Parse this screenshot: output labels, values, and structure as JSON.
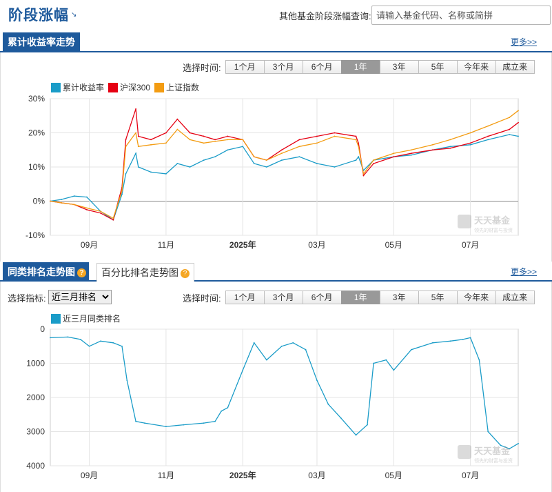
{
  "header": {
    "title": "阶段涨幅",
    "arrow": "↘",
    "query_label": "其他基金阶段涨幅查询:",
    "query_placeholder": "请输入基金代码、名称或简拼"
  },
  "section1": {
    "tab": "累计收益率走势",
    "more": "更多>>",
    "time_label": "选择时间:",
    "time_buttons": [
      "1个月",
      "3个月",
      "6个月",
      "1年",
      "3年",
      "5年",
      "今年来",
      "成立来"
    ],
    "active_time": "1年"
  },
  "section2": {
    "tab": "同类排名走势图",
    "tab2": "百分比排名走势图",
    "more": "更多>>",
    "indicator_label": "选择指标:",
    "indicator_value": "近三月排名",
    "time_label": "选择时间:",
    "time_buttons": [
      "1个月",
      "3个月",
      "6个月",
      "1年",
      "3年",
      "5年",
      "今年来",
      "成立来"
    ],
    "active_time": "1年"
  },
  "watermark": {
    "brand": "天天基金",
    "slogan": "领先的财富与投资"
  },
  "chart_data": [
    {
      "type": "line",
      "title": "",
      "xlabel": "",
      "ylabel": "",
      "y_unit": "%",
      "ylim": [
        -10,
        30
      ],
      "y_ticks": [
        "30%",
        "20%",
        "10%",
        "0%",
        "-10%"
      ],
      "y_tick_values": [
        30,
        20,
        10,
        0,
        -10
      ],
      "x_range": [
        "2024-08-01",
        "2025-08-08"
      ],
      "x_ticks": [
        "09月",
        "11月",
        "2025年",
        "03月",
        "05月",
        "07月"
      ],
      "x_tick_dates": [
        "2024-09-01",
        "2024-11-01",
        "2025-01-01",
        "2025-03-01",
        "2025-05-01",
        "2025-07-01"
      ],
      "grid": true,
      "legend": "top-left",
      "x": [
        "2024-08-01",
        "2024-08-10",
        "2024-08-20",
        "2024-08-30",
        "2024-09-10",
        "2024-09-20",
        "2024-09-27",
        "2024-09-30",
        "2024-10-08",
        "2024-10-10",
        "2024-10-20",
        "2024-11-01",
        "2024-11-10",
        "2024-11-20",
        "2024-12-01",
        "2024-12-10",
        "2024-12-20",
        "2025-01-01",
        "2025-01-10",
        "2025-01-20",
        "2025-02-01",
        "2025-02-15",
        "2025-03-01",
        "2025-03-15",
        "2025-04-01",
        "2025-04-03",
        "2025-04-07",
        "2025-04-15",
        "2025-05-01",
        "2025-05-15",
        "2025-06-01",
        "2025-06-15",
        "2025-07-01",
        "2025-07-15",
        "2025-08-01",
        "2025-08-08"
      ],
      "series": [
        {
          "name": "累计收益率",
          "color": "#1a9cc8",
          "values": [
            0,
            0.5,
            1.5,
            1.2,
            -3,
            -5.5,
            2,
            8,
            14,
            10,
            8.5,
            8,
            11,
            10,
            12,
            13,
            15,
            16,
            11,
            10,
            12,
            13,
            11,
            10,
            12,
            13,
            9,
            12,
            13,
            13.5,
            15,
            16,
            16.5,
            18,
            19.5,
            19
          ]
        },
        {
          "name": "沪深300",
          "color": "#e60012",
          "values": [
            0,
            -0.5,
            -1,
            -2.5,
            -3.5,
            -5.5,
            4,
            18,
            27,
            19,
            18,
            20,
            24,
            20,
            19,
            18,
            19,
            18,
            13,
            12,
            15,
            18,
            19,
            20,
            19,
            17,
            7.5,
            11,
            13,
            14,
            15,
            15.5,
            17,
            19,
            21,
            23
          ]
        },
        {
          "name": "上证指数",
          "color": "#f39c12",
          "values": [
            0,
            -0.5,
            -1,
            -2,
            -3,
            -5,
            3,
            16,
            20,
            16,
            16.5,
            17,
            21,
            18,
            17,
            17.5,
            18,
            18,
            13,
            12,
            14,
            16,
            17,
            19,
            18,
            16,
            8,
            12,
            14,
            15,
            16.5,
            18,
            20,
            22,
            24.5,
            26.5
          ]
        }
      ]
    },
    {
      "type": "line",
      "title": "",
      "xlabel": "",
      "ylabel": "",
      "ylim": [
        0,
        4000
      ],
      "y_inverted": true,
      "y_ticks": [
        "0",
        "1000",
        "2000",
        "3000",
        "4000"
      ],
      "y_tick_values": [
        0,
        1000,
        2000,
        3000,
        4000
      ],
      "x_range": [
        "2024-08-01",
        "2025-08-08"
      ],
      "x_ticks": [
        "09月",
        "11月",
        "2025年",
        "03月",
        "05月",
        "07月"
      ],
      "x_tick_dates": [
        "2024-09-01",
        "2024-11-01",
        "2025-01-01",
        "2025-03-01",
        "2025-05-01",
        "2025-07-01"
      ],
      "grid": true,
      "legend": "top-left",
      "x": [
        "2024-08-01",
        "2024-08-15",
        "2024-08-25",
        "2024-09-01",
        "2024-09-10",
        "2024-09-20",
        "2024-09-27",
        "2024-10-01",
        "2024-10-08",
        "2024-10-15",
        "2024-11-01",
        "2024-11-15",
        "2024-12-01",
        "2024-12-10",
        "2024-12-15",
        "2024-12-20",
        "2025-01-01",
        "2025-01-10",
        "2025-01-20",
        "2025-02-01",
        "2025-02-10",
        "2025-02-20",
        "2025-03-01",
        "2025-03-10",
        "2025-03-20",
        "2025-04-01",
        "2025-04-10",
        "2025-04-15",
        "2025-04-25",
        "2025-05-01",
        "2025-05-15",
        "2025-06-01",
        "2025-06-15",
        "2025-06-25",
        "2025-07-01",
        "2025-07-08",
        "2025-07-15",
        "2025-07-25",
        "2025-08-01",
        "2025-08-08"
      ],
      "series": [
        {
          "name": "近三月同类排名",
          "color": "#1a9cc8",
          "values": [
            250,
            230,
            300,
            500,
            350,
            400,
            500,
            1500,
            2700,
            2750,
            2850,
            2800,
            2750,
            2700,
            2400,
            2300,
            1200,
            400,
            900,
            500,
            400,
            600,
            1500,
            2200,
            2600,
            3100,
            2800,
            1000,
            900,
            1200,
            600,
            400,
            350,
            300,
            250,
            900,
            3000,
            3400,
            3500,
            3350
          ]
        }
      ]
    }
  ]
}
